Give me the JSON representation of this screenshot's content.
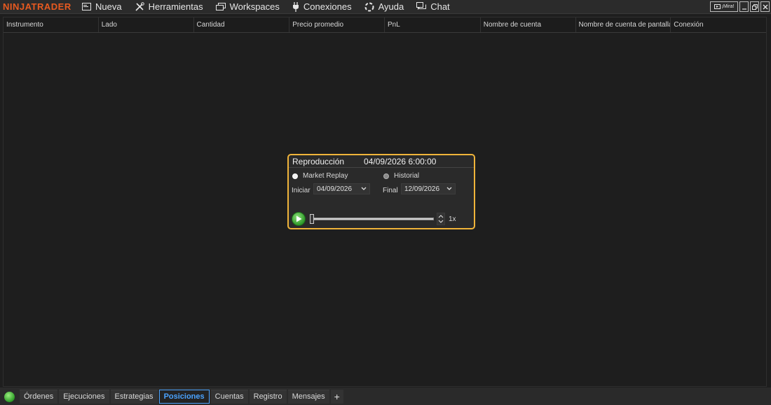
{
  "app": {
    "logo": "NINJATRADER"
  },
  "menu": [
    {
      "label": "Nueva",
      "icon": "new-window-icon"
    },
    {
      "label": "Herramientas",
      "icon": "tools-icon"
    },
    {
      "label": "Workspaces",
      "icon": "workspaces-icon"
    },
    {
      "label": "Conexiones",
      "icon": "plug-icon"
    },
    {
      "label": "Ayuda",
      "icon": "help-lifebuoy-icon"
    },
    {
      "label": "Chat",
      "icon": "chat-icon"
    }
  ],
  "window_controls": {
    "mira": "¡Mira!"
  },
  "grid": {
    "columns": [
      "Instrumento",
      "Lado",
      "Cantidad",
      "Precio promedio",
      "PnL",
      "Nombre de cuenta",
      "Nombre de cuenta de pantalla",
      "Conexión"
    ]
  },
  "playback": {
    "title": "Reproducción",
    "current_time": "04/09/2026 6:00:00",
    "mode_market_replay": "Market Replay",
    "mode_historical": "Historial",
    "selected_mode": "Market Replay",
    "start_label": "Iniciar",
    "start_date": "04/09/2026",
    "end_label": "Final",
    "end_date": "12/09/2026",
    "speed": "1x",
    "progress": 0
  },
  "tabs": [
    {
      "label": "Órdenes",
      "active": false
    },
    {
      "label": "Ejecuciones",
      "active": false
    },
    {
      "label": "Estrategias",
      "active": false
    },
    {
      "label": "Posiciones",
      "active": true
    },
    {
      "label": "Cuentas",
      "active": false
    },
    {
      "label": "Registro",
      "active": false
    },
    {
      "label": "Mensajes",
      "active": false
    }
  ],
  "tab_add": "+",
  "colors": {
    "accent": "#4aa3ff",
    "brand": "#e85a20",
    "panel_border": "#f0b43a",
    "status_connected": "#2d9c26"
  }
}
